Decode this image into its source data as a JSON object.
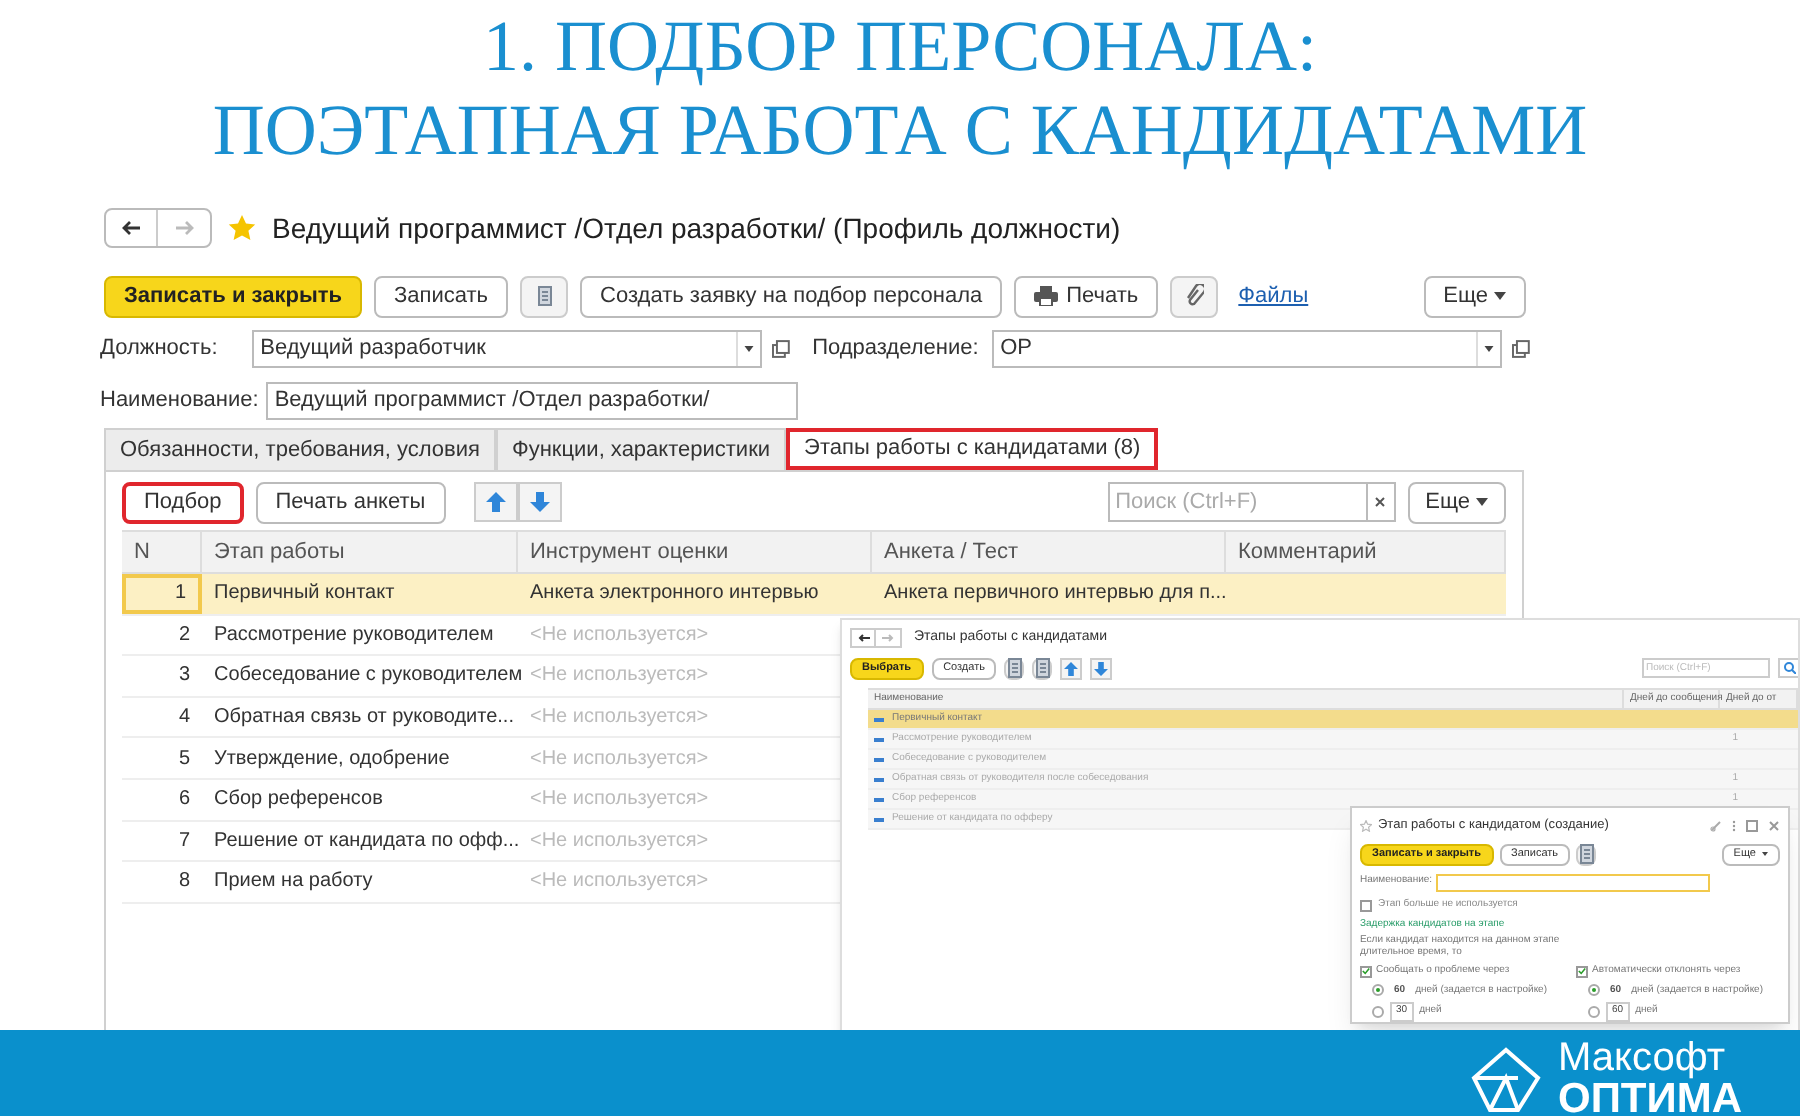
{
  "slide_title": [
    "1. ПОДБОР ПЕРСОНАЛА:",
    "ПОЭТАПНАЯ РАБОТА С КАНДИДАТАМИ"
  ],
  "form": {
    "title": "Ведущий программист /Отдел разработки/ (Профиль должности)",
    "toolbar": [
      {
        "kind": "primary",
        "label": "Записать и закрыть"
      },
      {
        "kind": "button",
        "label": "Записать"
      },
      {
        "kind": "icon"
      },
      {
        "kind": "button",
        "label": "Создать заявку на подбор персонала"
      },
      {
        "kind": "print",
        "label": "Печать"
      },
      {
        "kind": "clip"
      },
      {
        "kind": "link",
        "label": "Файлы"
      },
      {
        "kind": "more",
        "label": "Еще"
      }
    ],
    "position": {
      "label": "Должность:",
      "value": "Ведущий разработчик"
    },
    "department": {
      "label": "Подразделение:",
      "value": "ОР"
    },
    "name": {
      "label": "Наименование:",
      "value": "Ведущий программист /Отдел разработки/"
    },
    "tabs": [
      {
        "label": "Обязанности, требования, условия",
        "selected": false,
        "highlighted": false
      },
      {
        "label": "Функции, характеристики",
        "selected": false,
        "highlighted": false
      },
      {
        "label": "Этапы работы с кандидатами (8)",
        "selected": true,
        "highlighted": true
      }
    ],
    "panel_toolbar": [
      {
        "kind": "button",
        "label": "Подбор",
        "highlighted": true
      },
      {
        "kind": "button",
        "label": "Печать анкеты",
        "highlighted": false
      },
      {
        "kind": "up"
      },
      {
        "kind": "down"
      }
    ],
    "search": {
      "placeholder": "Поиск (Ctrl+F)"
    },
    "more": "Еще",
    "columns": [
      "N",
      "Этап работы",
      "Инструмент оценки",
      "Анкета / Тест",
      "Комментарий"
    ],
    "rows": [
      {
        "n": "1",
        "stage": "Первичный контакт",
        "tool": "Анкета электронного интервью",
        "tool_used": true,
        "form": "Анкета первичного интервью для п...",
        "selected": true
      },
      {
        "n": "2",
        "stage": "Рассмотрение руководителем",
        "tool": "<Не используется>",
        "tool_used": false,
        "selected": false
      },
      {
        "n": "3",
        "stage": "Собеседование с руководителем",
        "tool": "<Не используется>",
        "tool_used": false,
        "selected": false
      },
      {
        "n": "4",
        "stage": "Обратная связь от руководите...",
        "tool": "<Не используется>",
        "tool_used": false,
        "selected": false
      },
      {
        "n": "5",
        "stage": "Утверждение, одобрение",
        "tool": "<Не используется>",
        "tool_used": false,
        "selected": false
      },
      {
        "n": "6",
        "stage": "Сбор референсов",
        "tool": "<Не используется>",
        "tool_used": false,
        "selected": false
      },
      {
        "n": "7",
        "stage": "Решение от кандидата по офф...",
        "tool": "<Не используется>",
        "tool_used": false,
        "selected": false
      },
      {
        "n": "8",
        "stage": "Прием на работу",
        "tool": "<Не используется>",
        "tool_used": false,
        "selected": false
      }
    ]
  },
  "stages_window": {
    "title": "Этапы работы с кандидатами",
    "toolbar": [
      {
        "kind": "primary",
        "label": "Выбрать"
      },
      {
        "kind": "button",
        "label": "Создать"
      },
      {
        "kind": "icon"
      },
      {
        "kind": "icon"
      },
      {
        "kind": "up"
      },
      {
        "kind": "down"
      }
    ],
    "search": {
      "placeholder": "Поиск (Ctrl+F)"
    },
    "columns": [
      "Наименование",
      "Дней до сообщения",
      "Дней до от"
    ],
    "rows": [
      {
        "name": "Первичный контакт",
        "days": "",
        "selected": true
      },
      {
        "name": "Рассмотрение руководителем",
        "days": "1",
        "selected": false
      },
      {
        "name": "Собеседование с руководителем",
        "days": "",
        "selected": false
      },
      {
        "name": "Обратная связь от руководителя после собеседования",
        "days": "1",
        "selected": false
      },
      {
        "name": "Сбор референсов",
        "days": "1",
        "selected": false
      },
      {
        "name": "Решение от кандидата по офферу",
        "days": "",
        "selected": false
      }
    ]
  },
  "stage_dialog": {
    "title": "Этап работы с кандидатом (создание)",
    "toolbar": [
      {
        "kind": "primary",
        "label": "Записать и закрыть"
      },
      {
        "kind": "button",
        "label": "Записать"
      },
      {
        "kind": "icon"
      },
      {
        "kind": "more",
        "label": "Еще"
      }
    ],
    "name_label": "Наименование:",
    "unused": {
      "label": "Этап больше не используется",
      "checked": false
    },
    "delay_link": "Задержка кандидатов на этапе",
    "delay_text": "Если кандидат находится на данном этапе длительное время, то",
    "groups": [
      {
        "label": "Сообщать о проблеме через",
        "checked": true,
        "options": [
          {
            "value": "60",
            "unit": "дней (задается в настройке)",
            "selected": true
          },
          {
            "value": "30",
            "unit": "дней",
            "selected": false
          }
        ]
      },
      {
        "label": "Автоматически отклонять через",
        "checked": true,
        "options": [
          {
            "value": "60",
            "unit": "дней (задается в настройке)",
            "selected": true
          },
          {
            "value": "60",
            "unit": "дней",
            "selected": false
          }
        ]
      }
    ]
  },
  "brand": {
    "line_1": "Максофт",
    "line_2": "ОПТИМА"
  }
}
